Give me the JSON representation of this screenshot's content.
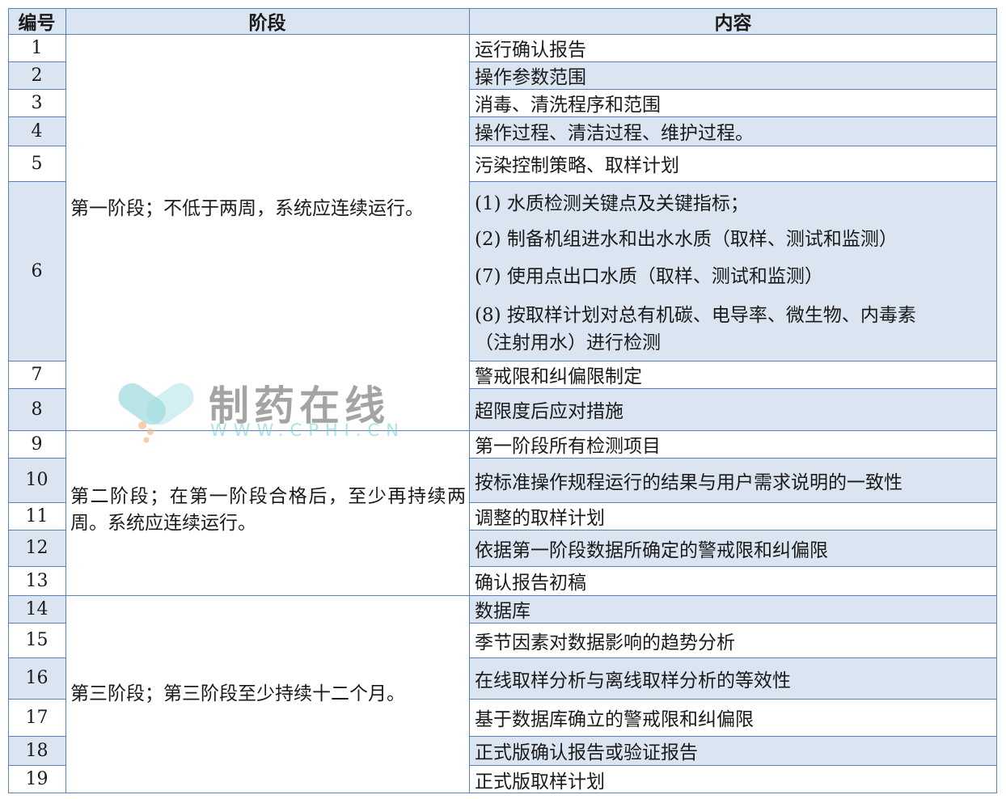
{
  "headers": {
    "num": "编号",
    "stage": "阶段",
    "content": "内容"
  },
  "stages": [
    "第一阶段；不低于两周，系统应连续运行。",
    "第二阶段；在第一阶段合格后，至少再持续两周。系统应连续运行。",
    "第三阶段；第三阶段至少持续十二个月。"
  ],
  "rows": [
    {
      "num": "1",
      "content": "运行确认报告"
    },
    {
      "num": "2",
      "content": "操作参数范围"
    },
    {
      "num": "3",
      "content": "消毒、清洗程序和范围"
    },
    {
      "num": "4",
      "content": "操作过程、清洁过程、维护过程。"
    },
    {
      "num": "5",
      "content": "污染控制策略、取样计划"
    },
    {
      "num": "6",
      "lines": [
        "(1) 水质检测关键点及关键指标；",
        "(2) 制备机组进水和出水水质（取样、测试和监测）",
        "(7) 使用点出口水质（取样、测试和监测）",
        "(8) 按取样计划对总有机碳、电导率、微生物、内毒素",
        "（注射用水）进行检测"
      ]
    },
    {
      "num": "7",
      "content": "警戒限和纠偏限制定"
    },
    {
      "num": "8",
      "content": "超限度后应对措施"
    },
    {
      "num": "9",
      "content": "第一阶段所有检测项目"
    },
    {
      "num": "10",
      "content": "按标准操作规程运行的结果与用户需求说明的一致性"
    },
    {
      "num": "11",
      "content": "调整的取样计划"
    },
    {
      "num": "12",
      "content": "依据第一阶段数据所确定的警戒限和纠偏限"
    },
    {
      "num": "13",
      "content": "确认报告初稿"
    },
    {
      "num": "14",
      "content": "数据库"
    },
    {
      "num": "15",
      "content": "季节因素对数据影响的趋势分析"
    },
    {
      "num": "16",
      "content": "在线取样分析与离线取样分析的等效性"
    },
    {
      "num": "17",
      "content": "基于数据库确立的警戒限和纠偏限"
    },
    {
      "num": "18",
      "content": "正式版确认报告或验证报告"
    },
    {
      "num": "19",
      "content": "正式版取样计划"
    }
  ],
  "watermark": {
    "logo_text": "制药在线",
    "url_text": "WWW.CPHI.CN",
    "colors": [
      "#7fd0d6",
      "#f2b88a",
      "#5a5a5a"
    ]
  },
  "colors": {
    "grid": "#5b7fb8",
    "header_fill": "#dbe5f1",
    "band_fill": "#dbe5f1",
    "white": "#ffffff"
  }
}
